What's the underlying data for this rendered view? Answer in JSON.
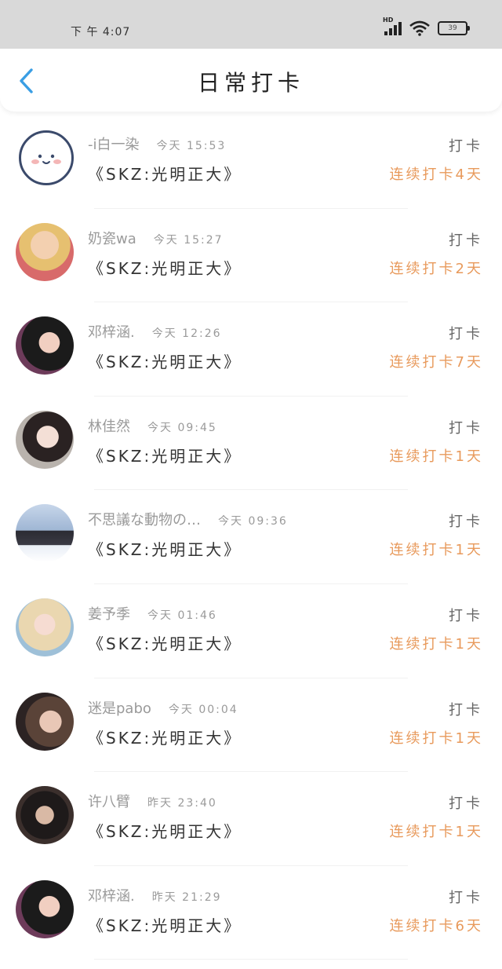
{
  "status": {
    "time": "下 午 4:07",
    "hd": "HD",
    "battery": "39"
  },
  "header": {
    "title": "日常打卡"
  },
  "colors": {
    "accent": "#e89a5c",
    "back": "#3a9ee4",
    "status_bg": "#d9d9d9"
  },
  "items": [
    {
      "name": "-i白一染",
      "time": "今天 15:53",
      "book": "《SKZ:光明正大》",
      "tag": "打卡",
      "streak": "连续打卡4天",
      "avatar": "smiley-face"
    },
    {
      "name": "奶瓷wa",
      "time": "今天 15:27",
      "book": "《SKZ:光明正大》",
      "tag": "打卡",
      "streak": "连续打卡2天",
      "avatar": "photo"
    },
    {
      "name": "邓梓涵.",
      "time": "今天 12:26",
      "book": "《SKZ:光明正大》",
      "tag": "打卡",
      "streak": "连续打卡7天",
      "avatar": "photo"
    },
    {
      "name": "林佳然",
      "time": "今天 09:45",
      "book": "《SKZ:光明正大》",
      "tag": "打卡",
      "streak": "连续打卡1天",
      "avatar": "photo"
    },
    {
      "name": "不思議な動物の…",
      "time": "今天 09:36",
      "book": "《SKZ:光明正大》",
      "tag": "打卡",
      "streak": "连续打卡1天",
      "avatar": "photo"
    },
    {
      "name": "姜予季",
      "time": "今天 01:46",
      "book": "《SKZ:光明正大》",
      "tag": "打卡",
      "streak": "连续打卡1天",
      "avatar": "photo"
    },
    {
      "name": "迷是pabo",
      "time": "今天 00:04",
      "book": "《SKZ:光明正大》",
      "tag": "打卡",
      "streak": "连续打卡1天",
      "avatar": "photo"
    },
    {
      "name": "许八臂",
      "time": "昨天 23:40",
      "book": "《SKZ:光明正大》",
      "tag": "打卡",
      "streak": "连续打卡1天",
      "avatar": "photo"
    },
    {
      "name": "邓梓涵.",
      "time": "昨天 21:29",
      "book": "《SKZ:光明正大》",
      "tag": "打卡",
      "streak": "连续打卡6天",
      "avatar": "photo"
    }
  ]
}
